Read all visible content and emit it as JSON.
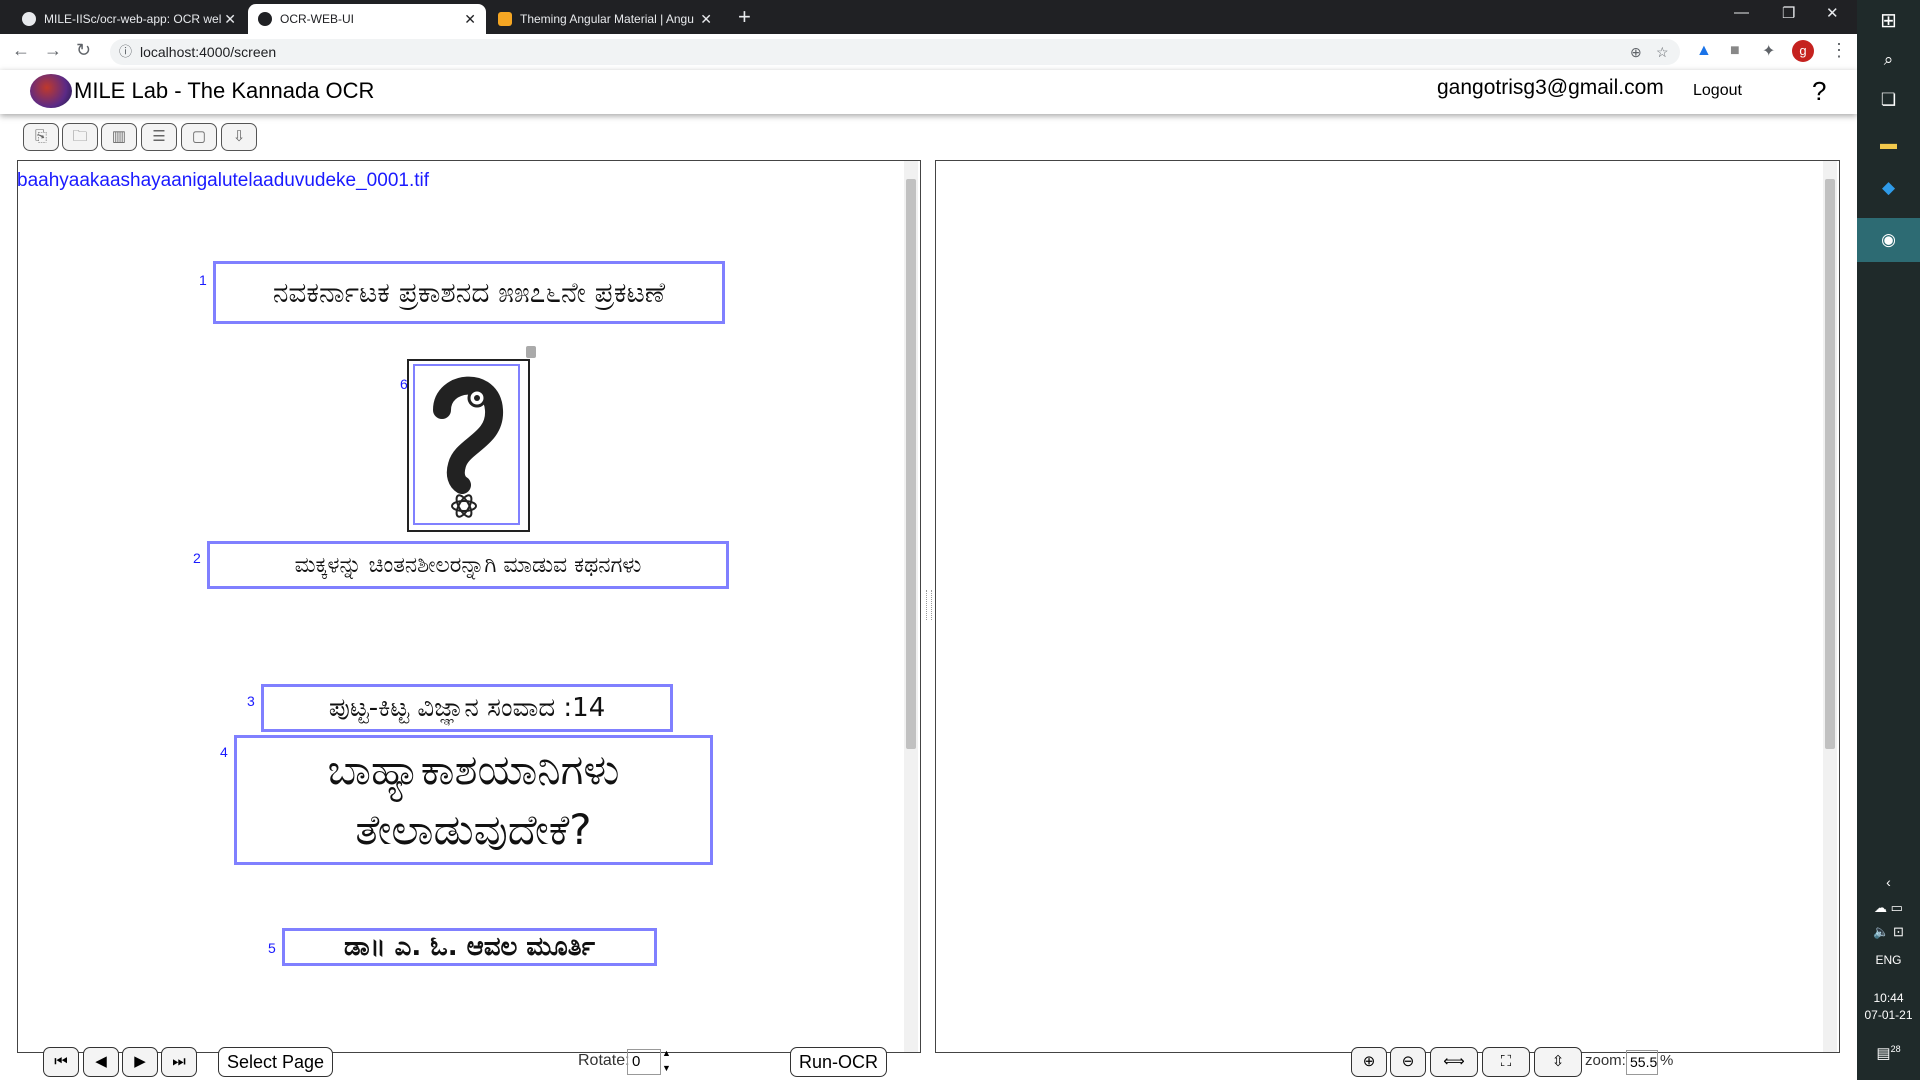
{
  "browser": {
    "tabs": [
      {
        "title": "MILE-IISc/ocr-web-app: OCR wel",
        "active": false
      },
      {
        "title": "OCR-WEB-UI",
        "active": true
      },
      {
        "title": "Theming Angular Material | Angu",
        "active": false
      }
    ],
    "new_tab": "+",
    "url": "localhost:4000/screen",
    "profile_initial": "g"
  },
  "app": {
    "title": "MILE Lab - The Kannada OCR",
    "user_email": "gangotrisg3@gmail.com",
    "logout_label": "Logout",
    "help_label": "?"
  },
  "toolbar": {
    "icons": [
      "upload-icon",
      "open-folder-icon",
      "columns-icon",
      "rows-icon",
      "select-box-icon",
      "download-icon"
    ]
  },
  "document": {
    "filename": "baahyaakaashayaanigalutelaaduvudeke_0001.tif",
    "regions": [
      {
        "number": "1",
        "text": "ನವಕರ್ನಾಟಕ ಪ್ರಕಾಶನದ ೫೫೭೬ನೇ ಪ್ರಕಟಣೆ"
      },
      {
        "number": "6",
        "text": ""
      },
      {
        "number": "2",
        "text": "ಮಕ್ಕಳನ್ನು ಚಿಂತನಶೀಲರನ್ನಾಗಿ ಮಾಡುವ ಕಥನಗಳು"
      },
      {
        "number": "3",
        "text": "ಪುಟ್ಟ-ಕಿಟ್ಟ ವಿಜ್ಞಾನ ಸಂವಾದ :14"
      },
      {
        "number": "4",
        "text_line1": "ಬಾಹ್ಯಾಕಾಶಯಾನಿಗಳು",
        "text_line2": "ತೇಲಾಡುವುದೇಕೆ?"
      },
      {
        "number": "5",
        "text": "ಡಾ॥ ಎ. ಓ. ಆವಲ ಮೂರ್ತಿ"
      }
    ]
  },
  "bottom_bar": {
    "select_page_label": "Select Page",
    "rotate_label": "Rotate:",
    "rotate_value": "0",
    "run_ocr_label": "Run-OCR",
    "zoom_label": "zoom:",
    "zoom_value": "55.5",
    "zoom_unit": "%"
  },
  "taskbar": {
    "language": "ENG",
    "time": "10:44",
    "date": "07-01-21",
    "notification_count": "28"
  }
}
